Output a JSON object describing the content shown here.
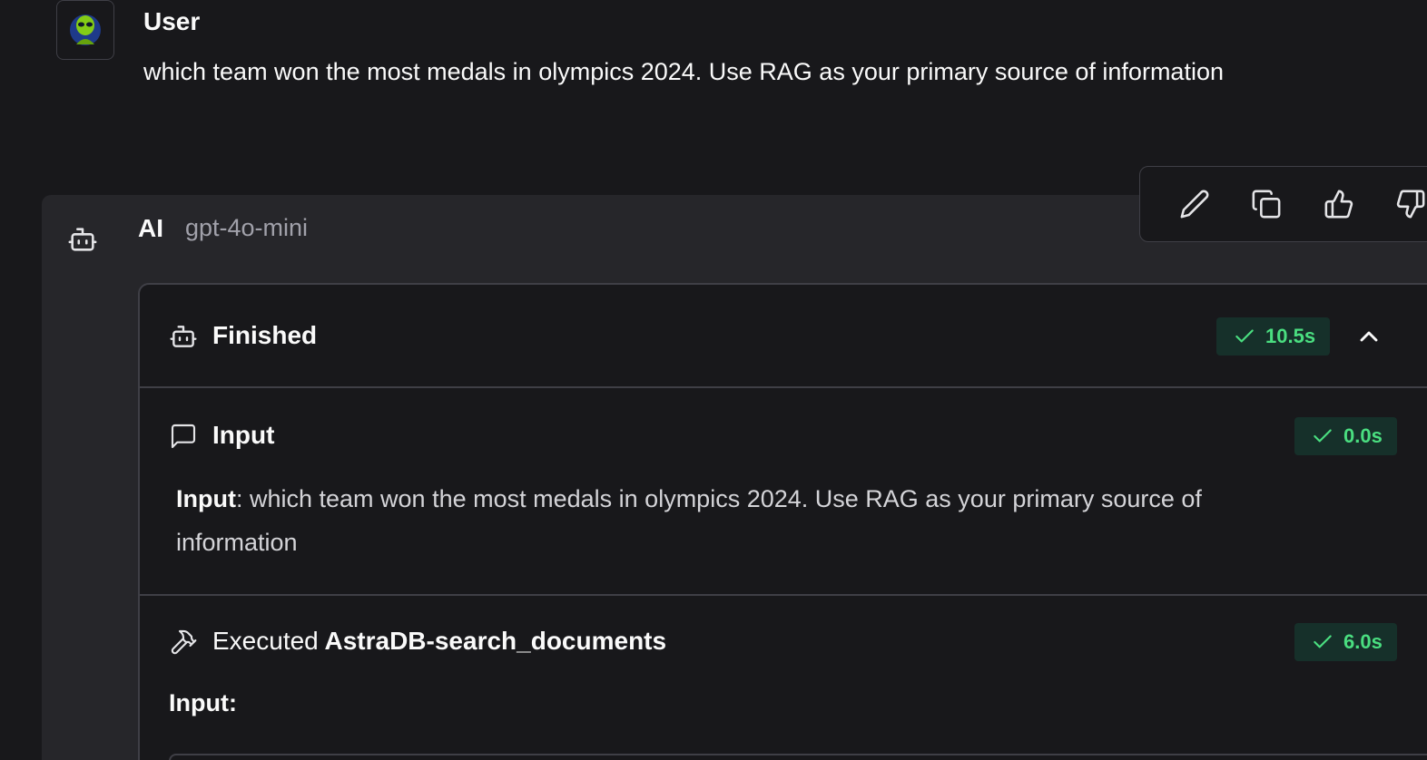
{
  "user": {
    "name": "User",
    "message": "which team won the most medals in olympics 2024. Use RAG as your primary source of information"
  },
  "ai": {
    "name": "AI",
    "model": "gpt-4o-mini"
  },
  "toolbar": {
    "edit_icon": "pencil-icon",
    "copy_icon": "copy-icon",
    "like_icon": "thumbs-up-icon",
    "dislike_icon": "thumbs-down-icon"
  },
  "steps": {
    "finished": {
      "title": "Finished",
      "duration": "10.5s"
    },
    "input": {
      "title": "Input",
      "duration": "0.0s",
      "label": "Input",
      "text": ": which team won the most medals in olympics 2024. Use RAG as your primary source of information"
    },
    "executed": {
      "prefix": "Executed",
      "tool": "AstraDB-search_documents",
      "duration": "6.0s",
      "input_label": "Input:"
    }
  },
  "colors": {
    "background": "#18181b",
    "ai_panel": "#26262a",
    "success_text": "#4ade80",
    "success_bg": "#16302a",
    "border": "#3f3f46"
  }
}
